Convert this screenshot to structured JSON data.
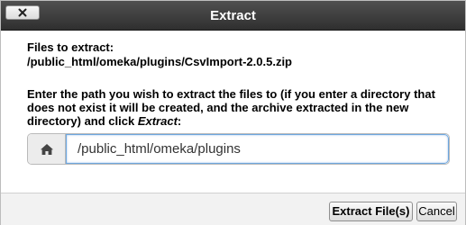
{
  "dialog": {
    "title": "Extract",
    "close_icon": "close-x-icon"
  },
  "files": {
    "label": "Files to extract:",
    "path": "/public_html/omeka/plugins/CsvImport-2.0.5.zip"
  },
  "instructions": {
    "text_before": "Enter the path you wish to extract the files to (if you enter a directory that does not exist it will be created, and the archive extracted in the new directory) and click ",
    "emphasis": "Extract",
    "text_after": ":"
  },
  "destination": {
    "addon_icon": "home-icon",
    "value": "/public_html/omeka/plugins"
  },
  "buttons": {
    "extract_label": "Extract File(s)",
    "cancel_label": "Cancel"
  }
}
